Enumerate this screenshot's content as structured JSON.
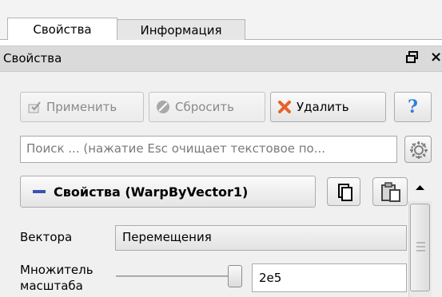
{
  "tabs": [
    {
      "label": "Свойства",
      "active": true
    },
    {
      "label": "Информация",
      "active": false
    }
  ],
  "dock": {
    "title": "Свойства",
    "close_glyph": "×"
  },
  "toolbar": {
    "apply_label": "Применить",
    "reset_label": "Сбросить",
    "delete_label": "Удалить",
    "help_glyph": "?"
  },
  "search": {
    "placeholder": "Поиск ... (нажатие Esc очищает текстовое по..."
  },
  "properties_header": {
    "label": "Свойства (WarpByVector1)"
  },
  "fields": {
    "vectors_label": "Вектора",
    "vectors_value": "Перемещения",
    "scale_label_line1": "Множитель",
    "scale_label_line2": "масштаба",
    "scale_value": "2e5"
  },
  "colors": {
    "accent": "#3b52b4",
    "delete_icon": "#e8622a",
    "help_icon": "#2f7fd6"
  }
}
